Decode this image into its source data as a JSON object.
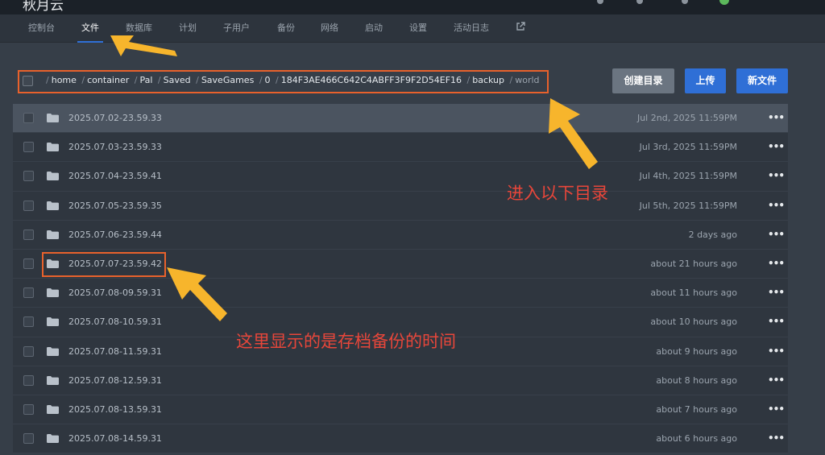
{
  "app": {
    "brand": "秋月云"
  },
  "nav": {
    "tabs": [
      {
        "label": "控制台"
      },
      {
        "label": "文件"
      },
      {
        "label": "数据库"
      },
      {
        "label": "计划"
      },
      {
        "label": "子用户"
      },
      {
        "label": "备份"
      },
      {
        "label": "网络"
      },
      {
        "label": "启动"
      },
      {
        "label": "设置"
      },
      {
        "label": "活动日志"
      }
    ],
    "active_tab": "文件",
    "external_link_icon": "external-link-icon"
  },
  "breadcrumb": {
    "segments": [
      "home",
      "container",
      "Pal",
      "Saved",
      "SaveGames",
      "0",
      "184F3AE466C642C4ABFF3F9F2D54EF16",
      "backup",
      "world"
    ],
    "separator": "/"
  },
  "actions": {
    "mkdir_label": "创建目录",
    "upload_label": "上传",
    "newfile_label": "新文件"
  },
  "files": [
    {
      "name": "2025.07.02-23.59.33",
      "modified": "Jul 2nd, 2025 11:59PM"
    },
    {
      "name": "2025.07.03-23.59.33",
      "modified": "Jul 3rd, 2025 11:59PM"
    },
    {
      "name": "2025.07.04-23.59.41",
      "modified": "Jul 4th, 2025 11:59PM"
    },
    {
      "name": "2025.07.05-23.59.35",
      "modified": "Jul 5th, 2025 11:59PM"
    },
    {
      "name": "2025.07.06-23.59.44",
      "modified": "2 days ago"
    },
    {
      "name": "2025.07.07-23.59.42",
      "modified": "about 21 hours ago"
    },
    {
      "name": "2025.07.08-09.59.31",
      "modified": "about 11 hours ago"
    },
    {
      "name": "2025.07.08-10.59.31",
      "modified": "about 10 hours ago"
    },
    {
      "name": "2025.07.08-11.59.31",
      "modified": "about 9 hours ago"
    },
    {
      "name": "2025.07.08-12.59.31",
      "modified": "about 8 hours ago"
    },
    {
      "name": "2025.07.08-13.59.31",
      "modified": "about 7 hours ago"
    },
    {
      "name": "2025.07.08-14.59.31",
      "modified": "about 6 hours ago"
    }
  ],
  "more_icon": "•••",
  "annotations": {
    "enter_dir": "进入以下目录",
    "backup_time": "这里显示的是存档备份的时间"
  },
  "colors": {
    "accent": "#2f6fd6",
    "highlight_box": "#e8612c",
    "note_text": "#e8463a",
    "arrow": "#f7b52c"
  }
}
